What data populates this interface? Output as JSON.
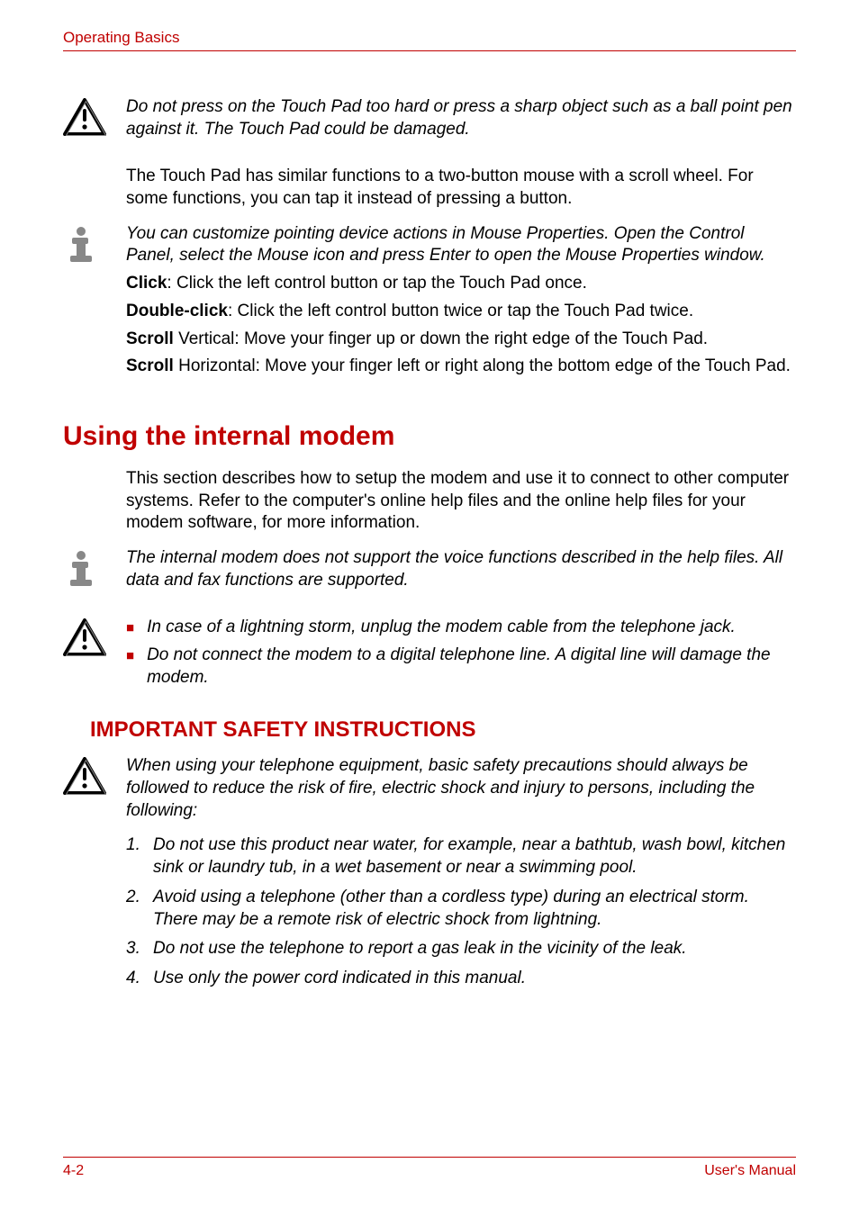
{
  "header": {
    "left": "Operating Basics"
  },
  "touchpad": {
    "caution": "Do not press on the Touch Pad too hard or press a sharp object such as a ball point pen against it. The Touch Pad could be damaged.",
    "para1": "The Touch Pad has similar functions to a two-button mouse with a scroll wheel. For some functions, you can tap it instead of pressing a button.",
    "note": "You can customize pointing device actions in Mouse Properties. Open the Control Panel, select the Mouse icon and press Enter to open the Mouse Properties window.",
    "click_label": "Click",
    "click_text": ":  Click the left control button or tap the Touch Pad once.",
    "dbl_label": "Double-click",
    "dbl_text": ": Click the left control button twice or tap the Touch Pad twice.",
    "scrollv_label": "Scroll",
    "scrollv_text": "  Vertical: Move your finger up or down the right edge of the Touch Pad.",
    "scrollh_label": "Scroll",
    "scrollh_text": "  Horizontal: Move your finger left or right along the bottom edge of the Touch Pad."
  },
  "modem": {
    "heading": "Using the internal modem",
    "intro": "This section describes how to setup the modem and use it to connect to other computer systems. Refer to the computer's online help files and the online help files for your modem software, for more information.",
    "note": "The internal modem does not support the voice functions described in the help files. All data and fax functions are supported.",
    "caution1": "In case of a lightning storm, unplug the modem cable from the telephone jack.",
    "caution2_a": "Do not connect the modem to a digital telephone line",
    "caution2_b": ". A digital line will damage the modem."
  },
  "safety": {
    "heading": "IMPORTANT SAFETY INSTRUCTIONS",
    "intro": "When using your telephone equipment, basic safety precautions should always be followed to reduce the risk of fire, electric shock and injury to persons, including the following:",
    "items": {
      "n1": "1.",
      "t1": "Do not use this product near water, for example, near a bathtub, wash bowl, kitchen sink or laundry tub, in a wet basement or near a swimming pool.",
      "n2": "2.",
      "t2": "Avoid using a telephone (other than a cordless type) during an electrical storm. There may be a remote risk of electric shock from lightning.",
      "n3": "3.",
      "t3": "Do not use the telephone to report a gas leak in the vicinity of the leak.",
      "n4": "4.",
      "t4": "Use only the power cord indicated in this manual."
    }
  },
  "footer": {
    "left": "4-2",
    "right": "User's Manual"
  }
}
